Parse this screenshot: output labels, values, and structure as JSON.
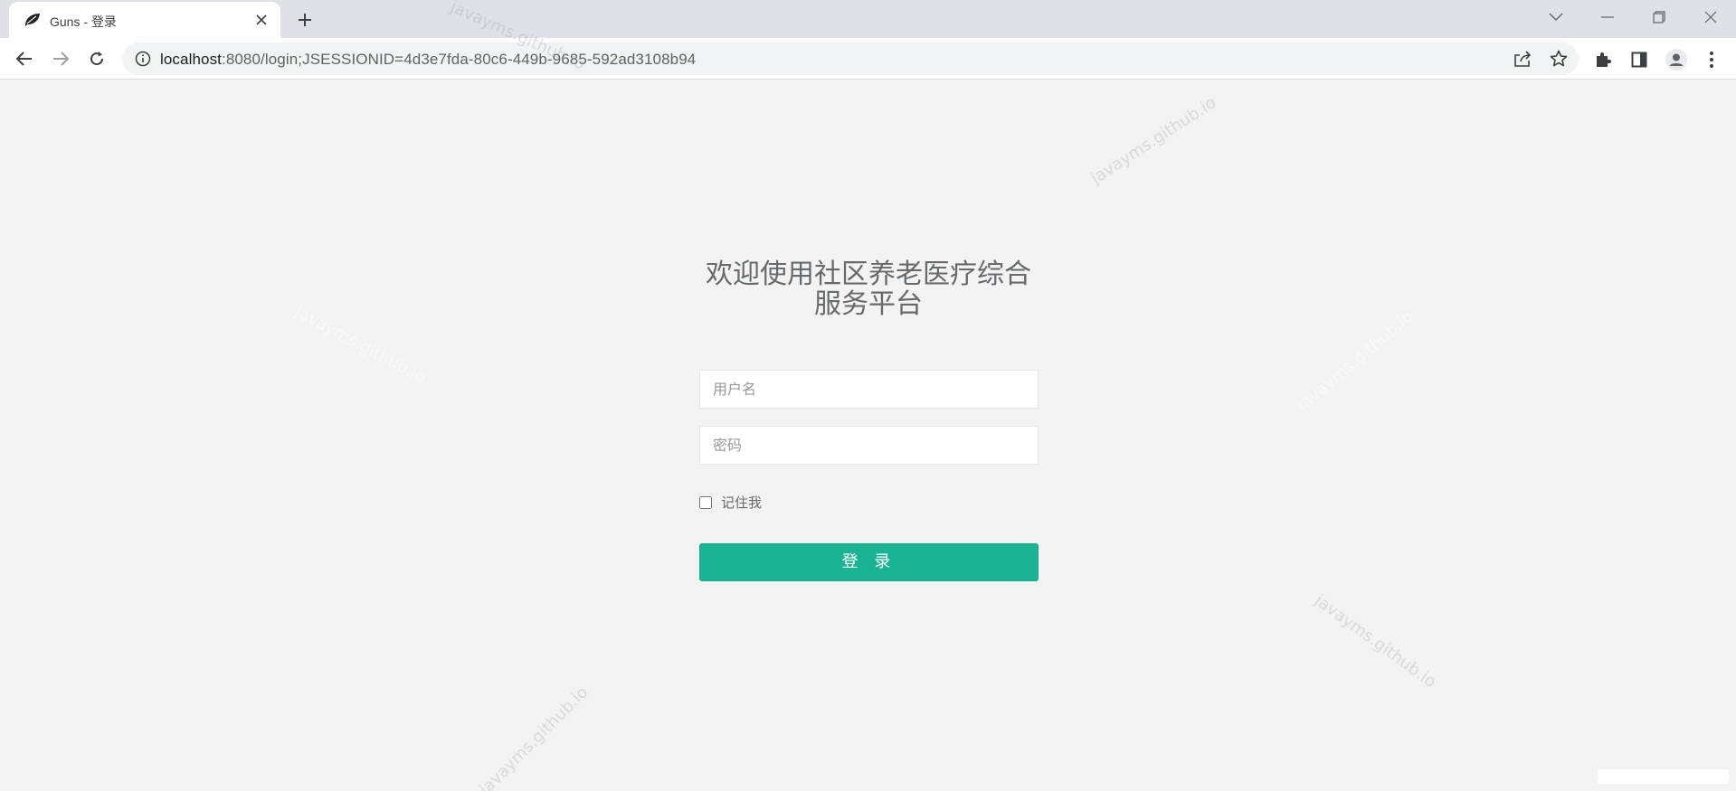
{
  "browser": {
    "tab": {
      "title": "Guns - 登录"
    },
    "address_bar": {
      "host": "localhost",
      "path": ":8080/login;JSESSIONID=4d3e7fda-80c6-449b-9685-592ad3108b94"
    }
  },
  "page": {
    "title_line1": "欢迎使用社区养老医疗综合",
    "title_line2": "服务平台",
    "username_placeholder": "用户名",
    "password_placeholder": "密码",
    "remember_label": "记住我",
    "login_button": "登 录",
    "watermark_text": "javayms.github.io",
    "accent_color": "#1ab394"
  }
}
